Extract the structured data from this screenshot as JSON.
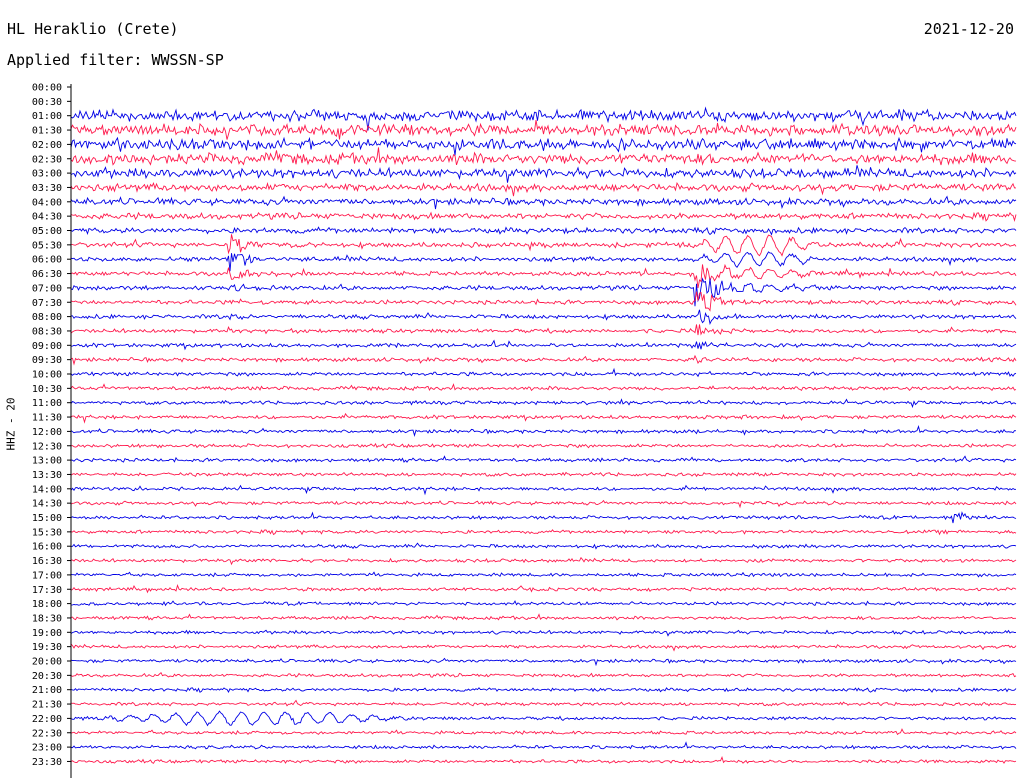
{
  "header": {
    "station": "HL Heraklio (Crete)",
    "date": "2021-12-20",
    "filter": "Applied filter: WWSSN-SP"
  },
  "side_label": "HHZ - 20",
  "colors": {
    "trace_a": "#0000e6",
    "trace_b": "#ff1a4d",
    "axis": "#000000"
  },
  "chart_data": {
    "type": "line",
    "title": "HL Heraklio (Crete)",
    "ylabel": "HHZ - 20",
    "row_labels": [
      "00:00",
      "00:30",
      "01:00",
      "01:30",
      "02:00",
      "02:30",
      "03:00",
      "03:30",
      "04:00",
      "04:30",
      "05:00",
      "05:30",
      "06:00",
      "06:30",
      "07:00",
      "07:30",
      "08:00",
      "08:30",
      "09:00",
      "09:30",
      "10:00",
      "10:30",
      "11:00",
      "11:30",
      "12:00",
      "12:30",
      "13:00",
      "13:30",
      "14:00",
      "14:30",
      "15:00",
      "15:30",
      "16:00",
      "16:30",
      "17:00",
      "17:30",
      "18:00",
      "18:30",
      "19:00",
      "19:30",
      "20:00",
      "20:30",
      "21:00",
      "21:30",
      "22:00",
      "22:30",
      "23:00",
      "23:30"
    ],
    "row_minutes": 30,
    "series_colors": [
      "#0000e6",
      "#ff1a4d"
    ],
    "row_noise_level": [
      0.0,
      0.0,
      1.0,
      1.0,
      1.0,
      1.0,
      0.85,
      0.7,
      0.6,
      0.55,
      0.5,
      0.45,
      0.42,
      0.4,
      0.4,
      0.38,
      0.38,
      0.36,
      0.35,
      0.35,
      0.34,
      0.34,
      0.33,
      0.33,
      0.33,
      0.32,
      0.32,
      0.32,
      0.32,
      0.31,
      0.31,
      0.31,
      0.31,
      0.31,
      0.3,
      0.3,
      0.3,
      0.3,
      0.3,
      0.3,
      0.3,
      0.3,
      0.3,
      0.3,
      0.3,
      0.3,
      0.3,
      0.3
    ],
    "events": [
      {
        "row": 11,
        "minute": 5.0,
        "amplitude": 1.6,
        "rows_span": 7
      },
      {
        "row": 11,
        "minute": 19.5,
        "amplitude": 1.4,
        "rows_span": 4,
        "type": "oscillation",
        "minute_end": 24
      },
      {
        "row": 13,
        "minute": 19.8,
        "amplitude": 2.8,
        "rows_span": 22
      },
      {
        "row": 30,
        "minute": 28.0,
        "amplitude": 0.9,
        "rows_span": 1
      },
      {
        "row": 44,
        "minute": 0.5,
        "amplitude": 0.9,
        "rows_span": 1,
        "type": "oscillation",
        "minute_end": 11
      }
    ]
  }
}
